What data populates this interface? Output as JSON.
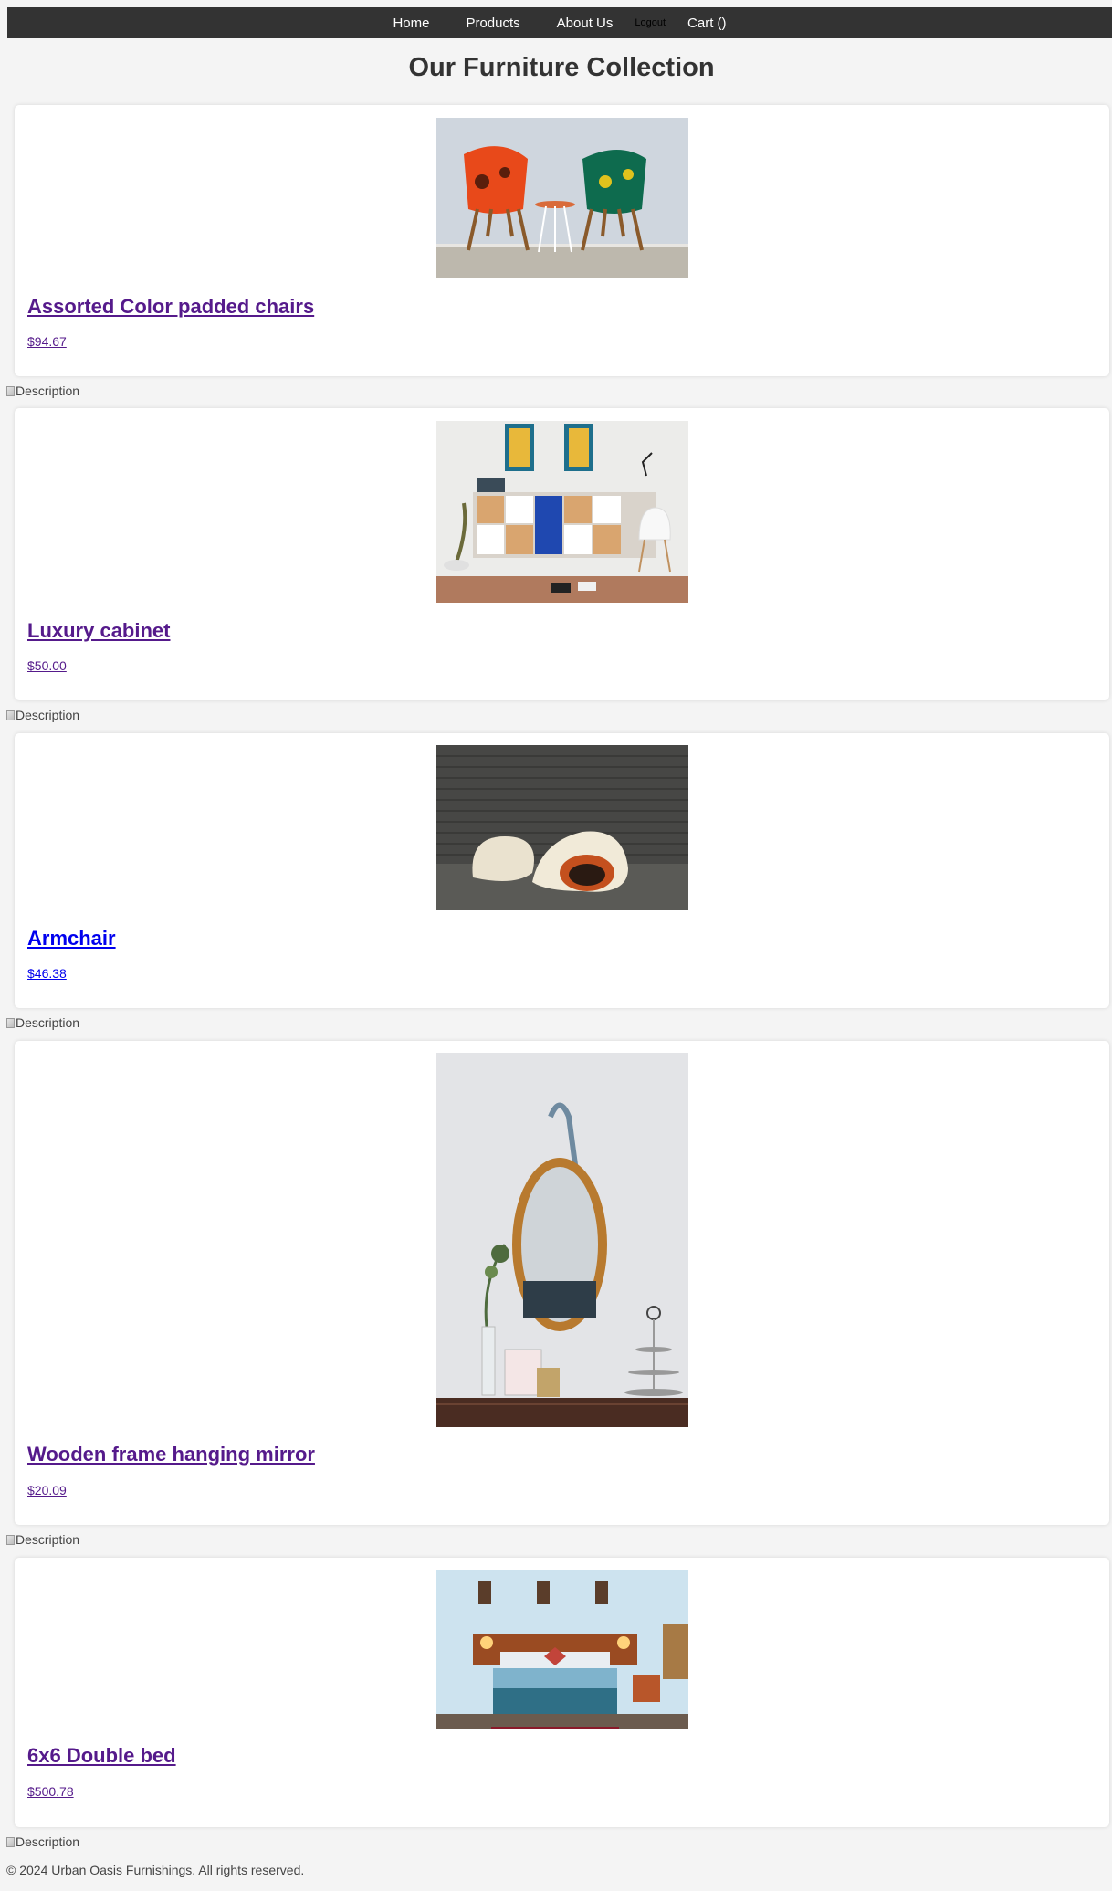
{
  "nav": {
    "home": "Home",
    "products": "Products",
    "about": "About Us",
    "logout": "Logout",
    "cart": "Cart ()"
  },
  "page_title": "Our Furniture Collection",
  "broken_image_alt": "Description",
  "products": [
    {
      "title": "Assorted Color padded chairs",
      "price": "$94.67",
      "image": "orange-and-teal-padded-chairs-photo"
    },
    {
      "title": "Luxury cabinet",
      "price": "$50.00",
      "image": "wall-cabinet-with-paintings-photo"
    },
    {
      "title": "Armchair",
      "price": "$46.38",
      "image": "white-shell-armchairs-photo"
    },
    {
      "title": "Wooden frame hanging mirror",
      "price": "$20.09",
      "image": "oval-hanging-mirror-photo"
    },
    {
      "title": "6x6 Double bed",
      "price": "$500.78",
      "image": "hotel-double-bed-photo"
    }
  ],
  "footer": "© 2024 Urban Oasis Furnishings. All rights reserved.",
  "colors": {
    "nav_bg": "#333333",
    "page_bg": "#f4f4f4",
    "visited_link": "#551a8b",
    "unvisited_link": "#0000ee"
  }
}
